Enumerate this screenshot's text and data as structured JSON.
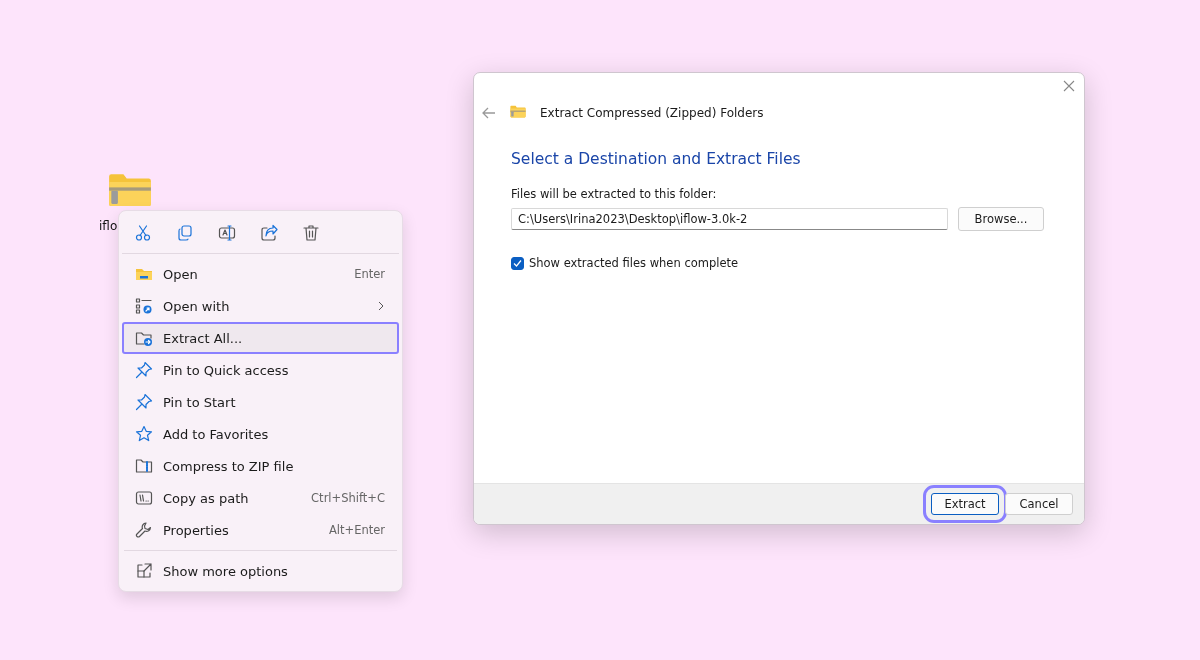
{
  "desktop_icon": {
    "label": "iflo"
  },
  "context_menu": {
    "toolbar": [
      {
        "kind": "cut"
      },
      {
        "kind": "copy"
      },
      {
        "kind": "rename"
      },
      {
        "kind": "share"
      },
      {
        "kind": "delete"
      }
    ],
    "items": [
      {
        "label": "Open",
        "shortcut": "Enter",
        "submenu": false,
        "highlighted": false
      },
      {
        "label": "Open with",
        "submenu": true,
        "highlighted": false
      },
      {
        "label": "Extract All...",
        "submenu": false,
        "highlighted": true
      },
      {
        "label": "Pin to Quick access",
        "submenu": false,
        "highlighted": false
      },
      {
        "label": "Pin to Start",
        "submenu": false,
        "highlighted": false
      },
      {
        "label": "Add to Favorites",
        "submenu": false,
        "highlighted": false
      },
      {
        "label": "Compress to ZIP file",
        "submenu": false,
        "highlighted": false
      },
      {
        "label": "Copy as path",
        "shortcut": "Ctrl+Shift+C",
        "submenu": false,
        "highlighted": false
      },
      {
        "label": "Properties",
        "shortcut": "Alt+Enter",
        "submenu": false,
        "highlighted": false
      }
    ],
    "footer_item": {
      "label": "Show more options"
    }
  },
  "dialog": {
    "title": "Extract Compressed (Zipped) Folders",
    "heading": "Select a Destination and Extract Files",
    "field_label": "Files will be extracted to this folder:",
    "path": "C:\\Users\\Irina2023\\Desktop\\iflow-3.0k-2",
    "browse": "Browse...",
    "show_files": {
      "label": "Show extracted files when complete",
      "checked": true
    },
    "buttons": [
      {
        "label": "Extract",
        "highlighted": true
      },
      {
        "label": "Cancel",
        "highlighted": false
      }
    ]
  }
}
